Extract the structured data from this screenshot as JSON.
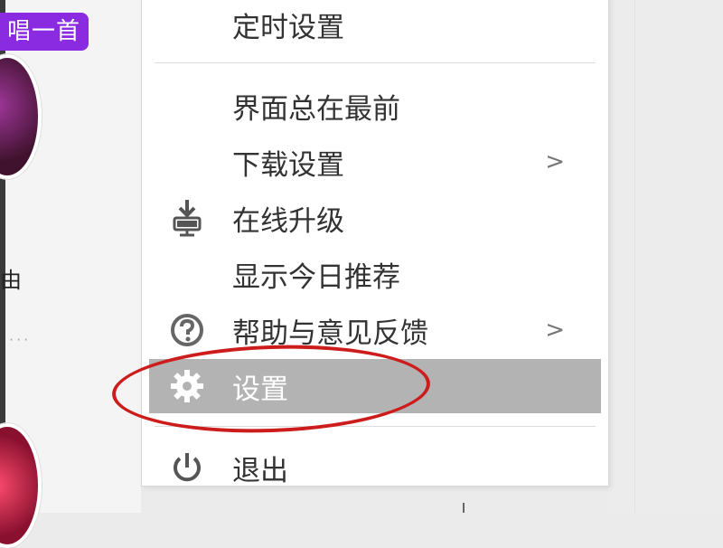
{
  "background": {
    "badge_text": "唱一首",
    "left_text": "由",
    "dots": "···"
  },
  "menu": {
    "items": [
      {
        "label": "定时设置",
        "icon": ""
      },
      {
        "label": "界面总在最前",
        "icon": ""
      },
      {
        "label": "下载设置",
        "icon": "",
        "submenu": true
      },
      {
        "label": "在线升级",
        "icon": "download-upgrade-icon"
      },
      {
        "label": "显示今日推荐",
        "icon": ""
      },
      {
        "label": "帮助与意见反馈",
        "icon": "help-icon",
        "submenu": true
      },
      {
        "label": "设置",
        "icon": "gear-icon",
        "selected": true
      },
      {
        "label": "退出",
        "icon": "power-icon"
      }
    ],
    "submenu_arrow": ">"
  },
  "colors": {
    "selected_bg": "#b3b3b3",
    "annotation": "#cc1c1c",
    "badge": "#8a2be2"
  }
}
